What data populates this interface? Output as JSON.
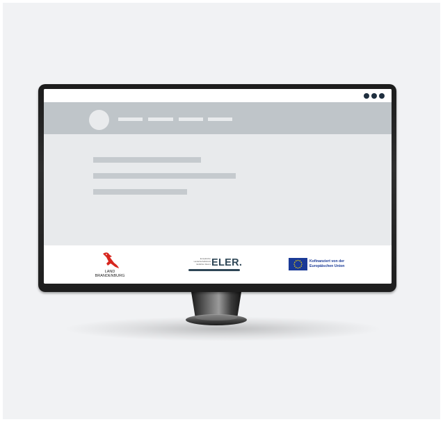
{
  "illustration": {
    "type": "desktop-monitor-mockup",
    "colors": {
      "background": "#f1f2f4",
      "bezel": "#1f1f1f",
      "navbar": "#bfc5c9",
      "placeholder": "#c5cace",
      "dots": "#1f2f3f"
    }
  },
  "window": {
    "menu_dots_icon": "three-dots"
  },
  "footer": {
    "brandenburg": {
      "line1": "LAND",
      "line2": "BRANDENBURG",
      "icon": "red-eagle"
    },
    "eler": {
      "line1": "Europäischer",
      "line2": "Landwirtschaftsfonds",
      "line3": "ländlichen Raums",
      "title": "ELER."
    },
    "eu": {
      "line1": "Kofinanziert von der",
      "line2": "Europäischen Union",
      "icon": "eu-flag"
    }
  }
}
